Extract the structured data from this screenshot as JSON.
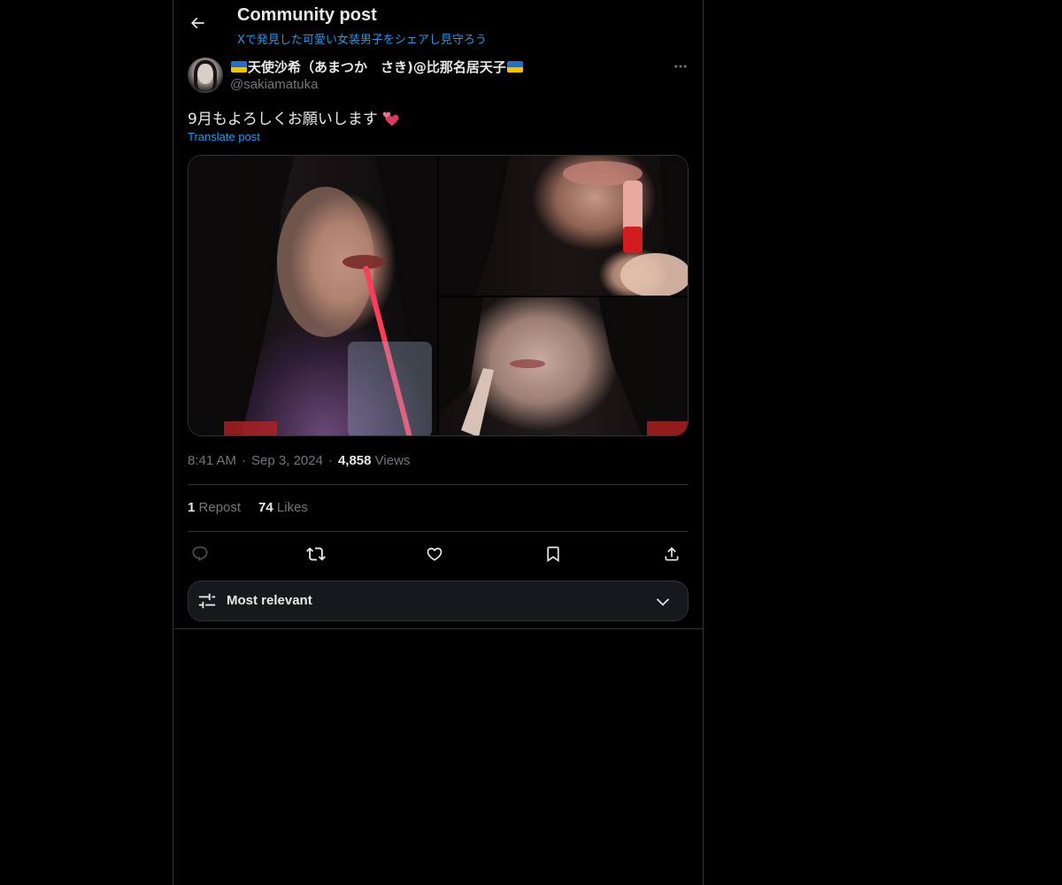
{
  "header": {
    "title": "Community post",
    "subtitle": "Xで発見した可愛い女装男子をシェアし見守ろう"
  },
  "author": {
    "display_name": "天使沙希（あまつか　さき)@比那名居天子",
    "handle": "@sakiamatuka",
    "flag_colors": [
      "#1f6fd1",
      "#f5c400"
    ]
  },
  "post": {
    "text": "9月もよろしくお願いします",
    "translate_label": "Translate post",
    "time": "8:41 AM",
    "date": "Sep 3, 2024",
    "views_count": "4,858",
    "views_label": "Views"
  },
  "stats": {
    "reposts_count": "1",
    "reposts_label": "Repost",
    "likes_count": "74",
    "likes_label": "Likes"
  },
  "sort": {
    "label": "Most relevant"
  },
  "colors": {
    "accent": "#1d9bf0",
    "muted": "#71767b",
    "text": "#e7e9ea",
    "border": "#2f3336",
    "background": "#000000"
  },
  "icons": [
    "back-arrow-icon",
    "more-icon",
    "reply-icon",
    "repost-icon",
    "like-icon",
    "bookmark-icon",
    "share-icon",
    "sliders-icon",
    "chevron-down-icon",
    "two-hearts-emoji"
  ]
}
